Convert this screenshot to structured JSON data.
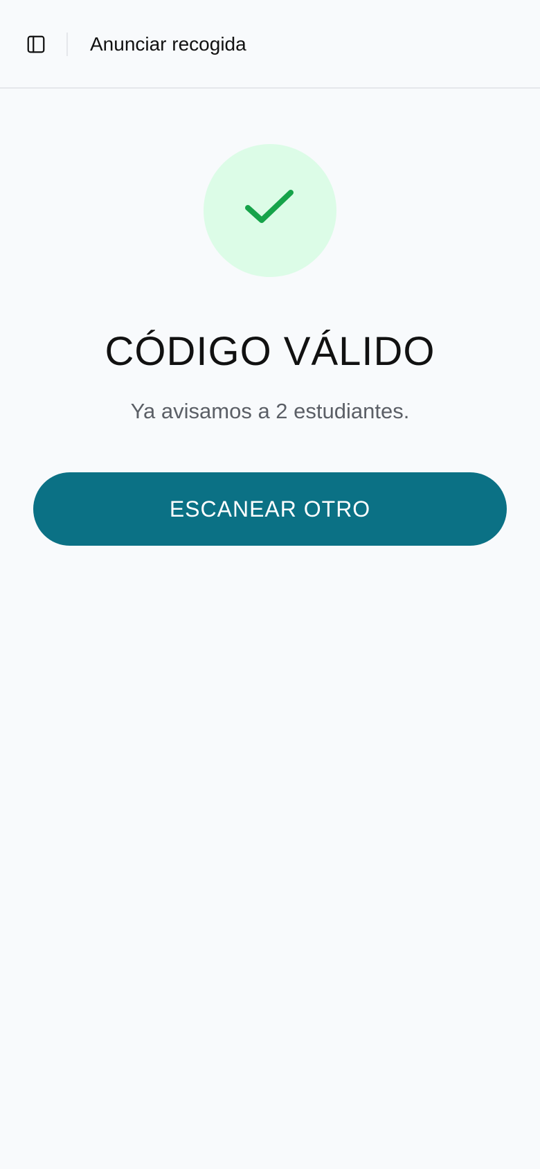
{
  "header": {
    "sidebar_toggle_icon": "sidebar-panel-icon",
    "title": "Anunciar recogida"
  },
  "result": {
    "status_icon": "check-icon",
    "status_color": "#16a34a",
    "status_bg_color": "#dcfce7",
    "title": "CÓDIGO VÁLIDO",
    "message": "Ya avisamos a 2 estudiantes."
  },
  "actions": {
    "scan_again_label": "ESCANEAR OTRO",
    "button_color": "#0b7185"
  }
}
